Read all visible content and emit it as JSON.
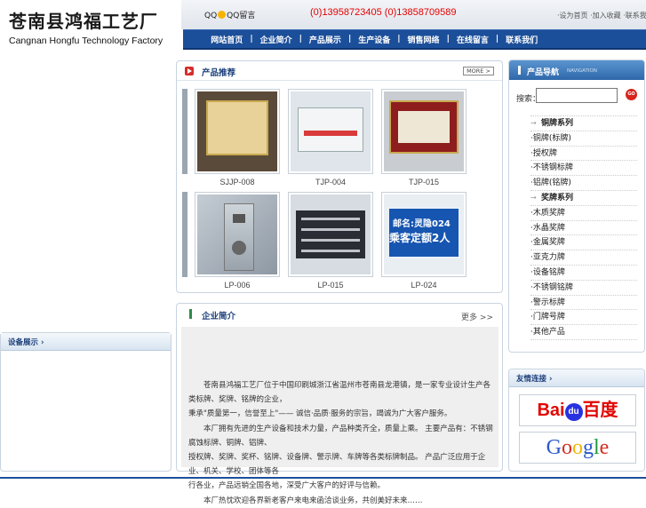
{
  "header": {
    "brand_cn": "苍南县鸿福工艺厂",
    "brand_en": "Cangnan Hongfu Technology  Factory",
    "qq_prefix": "QQ",
    "qq_label": "QQ留言",
    "phone": "(0)13958723405 (0)13858709589",
    "top_links": "·设为首页 ·加入收藏 ·联系我们"
  },
  "nav": [
    "网站首页",
    "企业简介",
    "产品展示",
    "生产设备",
    "销售网络",
    "在线留言",
    "联系我们"
  ],
  "left_panel": {
    "title": "设备展示 ›"
  },
  "products": {
    "title": "产品推荐",
    "more": "MORE >",
    "row1": [
      "SJJP-008",
      "TJP-004",
      "TJP-015"
    ],
    "row2": [
      "LP-006",
      "LP-015",
      "LP-024"
    ],
    "plaque_text_1": "邮名:灵隐024",
    "plaque_text_2": "乘客定额2人"
  },
  "intro": {
    "title": "企业简介",
    "more": "更多 >>",
    "lines": [
      "　　苍南县鸿福工艺厂位于中国印刷城浙江省温州市苍南县龙港镇，是一家专业设计生产各类标牌、奖牌、铭牌的企业，",
      "秉承\"质量第一，信誉至上\"—— 诚信·品质·服务的宗旨，竭诚为广大客户服务。",
      "　　本厂拥有先进的生产设备和技术力量，产品种类齐全，质量上乘。 主要产品有：不锈钢腐蚀标牌、铜牌、铝牌、",
      "授权牌、奖牌、奖杯、铭牌、设备牌、警示牌、车牌等各类标牌制品。 产品广泛应用于企业、机关、学校、团体等各",
      "行各业，产品远销全国各地，深受广大客户的好评与信赖。",
      "　　本厂热忱欢迎各界新老客户来电来函洽谈业务，共创美好未来……"
    ]
  },
  "catalog": {
    "title": "产品导航",
    "subtitle": "NAVIGATION",
    "search_label": "搜索：",
    "go": "GO",
    "items": [
      {
        "text": "铜牌系列",
        "head": true
      },
      {
        "text": "·铜牌(标牌)",
        "head": false
      },
      {
        "text": "·授权牌",
        "head": false
      },
      {
        "text": "·不锈钢标牌",
        "head": false
      },
      {
        "text": "·铝牌(铭牌)",
        "head": false
      },
      {
        "text": "奖牌系列",
        "head": true
      },
      {
        "text": "·木质奖牌",
        "head": false
      },
      {
        "text": "·水晶奖牌",
        "head": false
      },
      {
        "text": "·金属奖牌",
        "head": false
      },
      {
        "text": "·亚克力牌",
        "head": false
      },
      {
        "text": "·设备铭牌",
        "head": false
      },
      {
        "text": "·不锈钢铭牌",
        "head": false
      },
      {
        "text": "·警示标牌",
        "head": false
      },
      {
        "text": "·门牌号牌",
        "head": false
      },
      {
        "text": "·其他产品",
        "head": false
      }
    ]
  },
  "links": {
    "title": "友情连接 ›",
    "baidu_a": "Bai",
    "baidu_b": "du",
    "baidu_c": "百度",
    "google": [
      "G",
      "o",
      "o",
      "g",
      "l",
      "e"
    ]
  },
  "colors": {
    "nav_bg": "#1c4f9a",
    "phone": "#e60000",
    "accent": "#d72c2c"
  }
}
